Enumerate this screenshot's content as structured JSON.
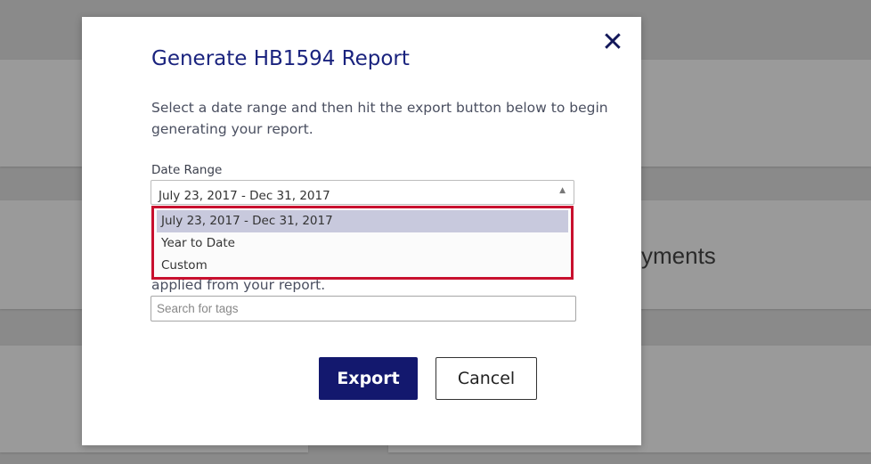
{
  "background": {
    "partial_text": "yments"
  },
  "modal": {
    "close_glyph": "✕",
    "title": "Generate HB1594 Report",
    "description": "Select a date range and then hit the export button below to begin generating your report.",
    "date_range": {
      "label": "Date Range",
      "selected_value": "July 23, 2017 - Dec 31, 2017",
      "arrow_glyph": "▲",
      "options": [
        "July 23, 2017 - Dec 31, 2017",
        "Year to Date",
        "Custom"
      ],
      "highlighted_index": 0
    },
    "partially_hidden_text": "applied from your report.",
    "tags": {
      "placeholder": "Search for tags",
      "value": ""
    },
    "buttons": {
      "export_label": "Export",
      "cancel_label": "Cancel"
    }
  },
  "colors": {
    "title": "#1a237e",
    "export_button": "#13186e",
    "dropdown_highlight_border": "#c8102e",
    "selected_option_bg": "#c8c9dd"
  }
}
